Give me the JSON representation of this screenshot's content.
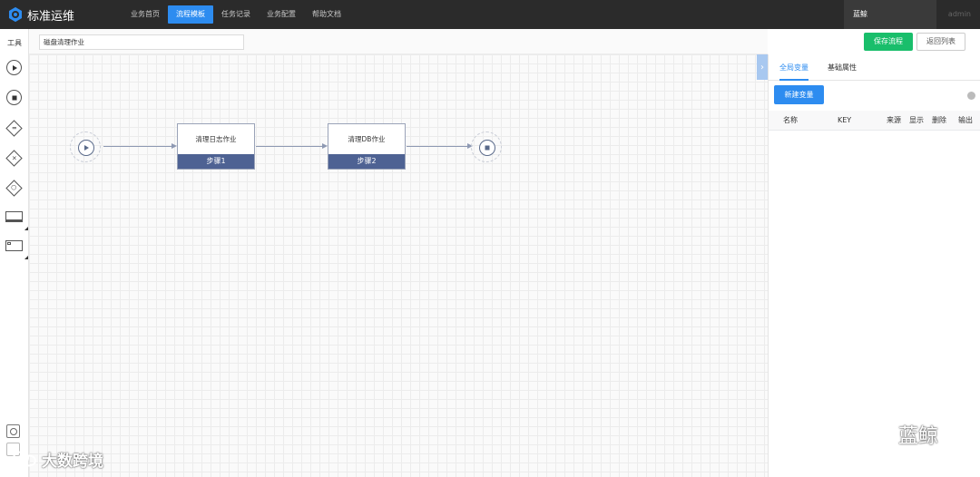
{
  "app": {
    "title": "标准运维",
    "logo_icon": "gear-logo-icon"
  },
  "nav": {
    "items": [
      {
        "label": "业务首页",
        "active": false
      },
      {
        "label": "流程模板",
        "active": true
      },
      {
        "label": "任务记录",
        "active": false
      },
      {
        "label": "业务配置",
        "active": false
      },
      {
        "label": "帮助文档",
        "active": false
      }
    ],
    "user": "蓝鲸",
    "admin": "admin"
  },
  "toolbar": {
    "label": "工具",
    "tools": [
      "start-event-icon",
      "end-event-icon",
      "parallel-gateway-icon",
      "exclusive-gateway-icon",
      "converge-gateway-icon",
      "task-node-icon",
      "subprocess-node-icon"
    ]
  },
  "flow": {
    "name": "磁盘清理作业",
    "save_label": "保存流程",
    "back_label": "返回列表",
    "nodes": [
      {
        "title": "清理日志作业",
        "step": "步骤1"
      },
      {
        "title": "清理DB作业",
        "step": "步骤2"
      }
    ]
  },
  "panel": {
    "tabs": [
      "全局变量",
      "基础属性"
    ],
    "active_tab": 0,
    "new_var_label": "新建变量",
    "columns": [
      "名称",
      "KEY",
      "来源",
      "显示",
      "删除",
      "输出"
    ],
    "rows": []
  },
  "watermarks": {
    "left": "大数跨境",
    "right": "蓝鲸"
  },
  "colors": {
    "topbar": "#2b2b2b",
    "accent": "#2d8cf0",
    "save": "#19be6b",
    "step_bar": "#4e6293"
  }
}
